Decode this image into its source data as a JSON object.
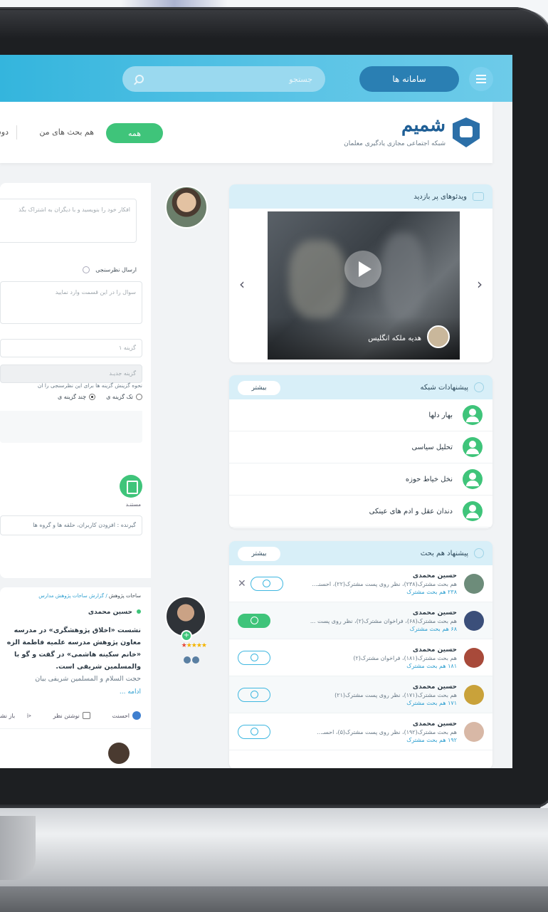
{
  "topbar": {
    "systems_label": "سامانه ها",
    "search_placeholder": "جستجو"
  },
  "header": {
    "logo_title": "شمیم",
    "logo_subtitle": "شبکه اجتماعی مجازی یادگیری معلمان",
    "tabs": [
      {
        "label": "همه"
      },
      {
        "label": "هم بحث های من"
      },
      {
        "label": "دوستان"
      }
    ]
  },
  "videos": {
    "title": "ویدئوهای پر بازدید",
    "caption": "هدیه ملکه انگلیس"
  },
  "network_suggestions": {
    "title": "پیشنهادات شبکه",
    "more_label": "بیشتر",
    "items": [
      "بهار دلها",
      "تحلیل سیاسی",
      "نخل خیاط حوزه",
      "دندان عقل و ادم های عینکی"
    ]
  },
  "peer_suggestions": {
    "title": "پیشنهاد هم بحث",
    "more_label": "بیشتر",
    "items": [
      {
        "name": "حسین محمدی",
        "desc": "هم بحث مشترک(۲۳۸)، نظر روی پست مشترک(۲۲)، احسنـ...",
        "common": "۲۳۸ هم بحث مشترک",
        "color": "#6d8c7a",
        "following": false
      },
      {
        "name": "حسین محمدی",
        "desc": "هم بحث مشترک(۶۸)، فراخوان مشترک(۲)، نظر روی پست ...",
        "common": "۶۸ هم بحث مشترک",
        "color": "#3b4f7a",
        "following": true
      },
      {
        "name": "حسین محمدی",
        "desc": "هم بحث مشترک(۱۸۱)، فراخوان مشترک(۲)",
        "common": "۱۸۱ هم بحث مشترک",
        "color": "#a84a3a",
        "following": false
      },
      {
        "name": "حسین محمدی",
        "desc": "هم بحث مشترک(۱۷۱)، نظر روی پست مشترک(۲۱)",
        "common": "۱۷۱ هم بحث مشترک",
        "color": "#c9a23a",
        "following": false
      },
      {
        "name": "حسین محمدی",
        "desc": "هم بحث مشترک(۱۹۲)، نظر روی پست مشترک(۵)، احسـ...",
        "common": "۱۹۲ هم بحث مشترک",
        "color": "#d8b8a6",
        "following": false
      }
    ]
  },
  "composer": {
    "placeholder": "افکار خود را بنویسید و با دیگران به اشتراک بگذ",
    "poll_label": "ارسال نظرسنجی",
    "poll_question_placeholder": "سوال را در این قسمت وارد نمایید",
    "option_1": "گزینه ۱",
    "option_new": "گزینه جدیـد",
    "poll_mode_text": "نحوه گزینش گزینه ها برای این نظرسنجی را ان",
    "choice_single": "تک گزینه ی",
    "choice_multi": "چند گزینه ی",
    "doc_label": "مستنـد",
    "recipients_placeholder": "گیرنده : افزودن کاربران، حلقه ها و گروه ها"
  },
  "post": {
    "breadcrumb_root": "ساحات پژوهش",
    "breadcrumb_leaf": "گزارش ساحات پژوهش مدارس",
    "author": "حسین محمدی",
    "lines": [
      "نشست «اخلاق پژوهشگری» در مدرسه",
      "معاون پژوهش مدرسه علمیه فاطمة الزه",
      "«خانم سکینه هاشمی» در گفت و گو با",
      "والمسلمین شریفی است."
    ],
    "faded_line": "حجت السلام و المسلمین شریفی بیان",
    "read_more": "ادامه ...",
    "actions": {
      "like": "احسنت",
      "comment": "نوشتن نظر",
      "share": "باز نشر"
    }
  }
}
